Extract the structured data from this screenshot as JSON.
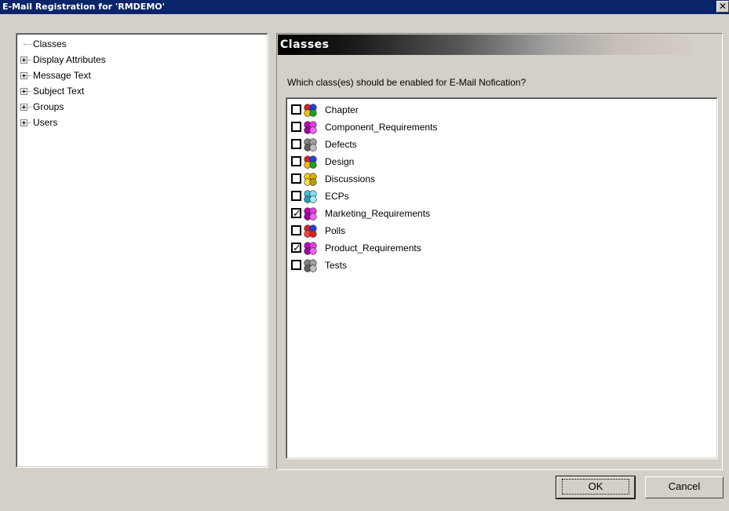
{
  "window": {
    "title": "E-Mail Registration for 'RMDEMO'",
    "close_glyph": "✕"
  },
  "tree": {
    "items": [
      {
        "label": "Classes",
        "expandable": false
      },
      {
        "label": "Display Attributes",
        "expandable": true
      },
      {
        "label": "Message Text",
        "expandable": true
      },
      {
        "label": "Subject Text",
        "expandable": true
      },
      {
        "label": "Groups",
        "expandable": true
      },
      {
        "label": "Users",
        "expandable": true
      }
    ]
  },
  "panel": {
    "header": "Classes",
    "question": "Which class(es) should be enabled for E-Mail Nofication?"
  },
  "classes": [
    {
      "label": "Chapter",
      "checked": false,
      "icon": "class-icon-multicolor",
      "colors": [
        "#e02020",
        "#2040e0",
        "#f0c000",
        "#20a020"
      ]
    },
    {
      "label": "Component_Requirements",
      "checked": false,
      "icon": "class-icon-magenta",
      "colors": [
        "#c000c0",
        "#e040e0",
        "#a000a0",
        "#ff60ff"
      ]
    },
    {
      "label": "Defects",
      "checked": false,
      "icon": "class-icon-gray",
      "colors": [
        "#808080",
        "#a0a0a0",
        "#606060",
        "#c0c0c0"
      ]
    },
    {
      "label": "Design",
      "checked": false,
      "icon": "class-icon-multicolor",
      "colors": [
        "#e02020",
        "#2040e0",
        "#f0c000",
        "#20a020"
      ]
    },
    {
      "label": "Discussions",
      "checked": false,
      "icon": "class-icon-yellow",
      "colors": [
        "#f0d000",
        "#e0b000",
        "#ffe040",
        "#c0a000"
      ]
    },
    {
      "label": "ECPs",
      "checked": false,
      "icon": "class-icon-cyan",
      "colors": [
        "#40c0e0",
        "#80e0f0",
        "#20a0c0",
        "#a0f0ff"
      ]
    },
    {
      "label": "Marketing_Requirements",
      "checked": true,
      "icon": "class-icon-magenta",
      "colors": [
        "#c000c0",
        "#e040e0",
        "#a000a0",
        "#ff60ff"
      ]
    },
    {
      "label": "Polls",
      "checked": false,
      "icon": "class-icon-red-blue",
      "colors": [
        "#e02020",
        "#2040e0",
        "#ff4040",
        "#e02020"
      ]
    },
    {
      "label": "Product_Requirements",
      "checked": true,
      "icon": "class-icon-magenta",
      "colors": [
        "#c000c0",
        "#e040e0",
        "#a000a0",
        "#ff60ff"
      ]
    },
    {
      "label": "Tests",
      "checked": false,
      "icon": "class-icon-gray",
      "colors": [
        "#808080",
        "#a0a0a0",
        "#606060",
        "#c0c0c0"
      ]
    }
  ],
  "buttons": {
    "ok": "OK",
    "cancel": "Cancel"
  }
}
